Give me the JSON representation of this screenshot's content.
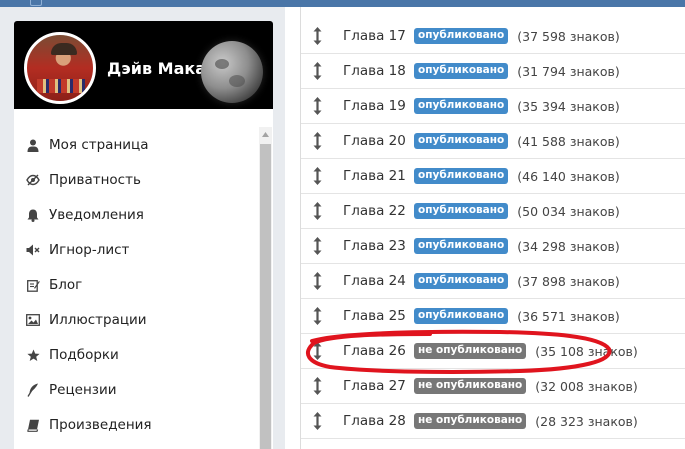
{
  "profile": {
    "name": "Дэйв Макара"
  },
  "menu": {
    "items": [
      {
        "label": "Моя страница",
        "icon": "user-icon"
      },
      {
        "label": "Приватность",
        "icon": "eye-slash-icon"
      },
      {
        "label": "Уведомления",
        "icon": "bell-icon"
      },
      {
        "label": "Игнор-лист",
        "icon": "volume-off-icon"
      },
      {
        "label": "Блог",
        "icon": "edit-icon"
      },
      {
        "label": "Иллюстрации",
        "icon": "picture-icon"
      },
      {
        "label": "Подборки",
        "icon": "star-icon"
      },
      {
        "label": "Рецензии",
        "icon": "feather-icon"
      },
      {
        "label": "Произведения",
        "icon": "book-icon"
      }
    ]
  },
  "chapters": [
    {
      "title": "Глава 17",
      "status": "опубликовано",
      "published": true,
      "chars": "(37 598 знаков)"
    },
    {
      "title": "Глава 18",
      "status": "опубликовано",
      "published": true,
      "chars": "(31 794 знаков)"
    },
    {
      "title": "Глава 19",
      "status": "опубликовано",
      "published": true,
      "chars": "(35 394 знаков)"
    },
    {
      "title": "Глава 20",
      "status": "опубликовано",
      "published": true,
      "chars": "(41 588 знаков)"
    },
    {
      "title": "Глава 21",
      "status": "опубликовано",
      "published": true,
      "chars": "(46 140 знаков)"
    },
    {
      "title": "Глава 22",
      "status": "опубликовано",
      "published": true,
      "chars": "(50 034 знаков)"
    },
    {
      "title": "Глава 23",
      "status": "опубликовано",
      "published": true,
      "chars": "(34 298 знаков)"
    },
    {
      "title": "Глава 24",
      "status": "опубликовано",
      "published": true,
      "chars": "(37 898 знаков)"
    },
    {
      "title": "Глава 25",
      "status": "опубликовано",
      "published": true,
      "chars": "(36 571 знаков)"
    },
    {
      "title": "Глава 26",
      "status": "не опубликовано",
      "published": false,
      "chars": "(35 108 знаков)"
    },
    {
      "title": "Глава 27",
      "status": "не опубликовано",
      "published": false,
      "chars": "(32 008 знаков)"
    },
    {
      "title": "Глава 28",
      "status": "не опубликовано",
      "published": false,
      "chars": "(28 323 знаков)"
    }
  ],
  "colors": {
    "published_badge": "#428bca",
    "unpublished_badge": "#777777",
    "annotation": "#e0141e",
    "topbar": "#4a76a8"
  }
}
